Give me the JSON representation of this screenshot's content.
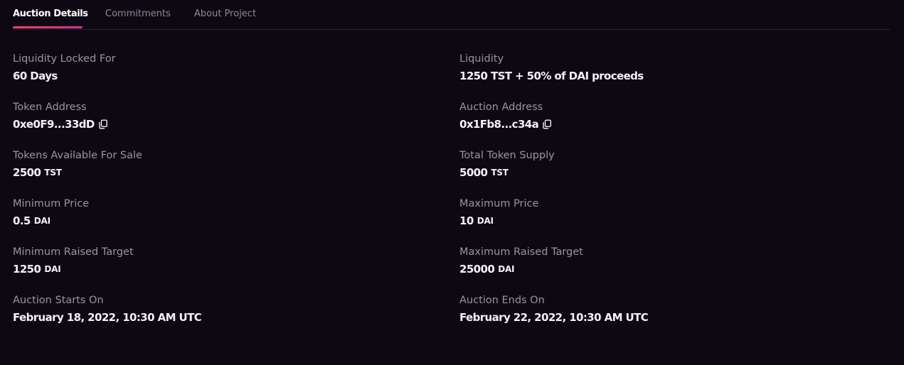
{
  "tabs": [
    {
      "label": "Auction Details",
      "active": true
    },
    {
      "label": "Commitments",
      "active": false
    },
    {
      "label": "About Project",
      "active": false
    }
  ],
  "colors": {
    "background": "#0d0812",
    "accent_gradient_start": "#f0436a",
    "accent_gradient_end": "#c23ba4"
  },
  "details": {
    "liquidity_locked": {
      "label": "Liquidity Locked For",
      "value": "60 Days"
    },
    "liquidity": {
      "label": "Liquidity",
      "value": "1250 TST + 50% of DAI proceeds"
    },
    "token_address": {
      "label": "Token Address",
      "value": "0xe0F9...33dD",
      "icon": "copy-icon"
    },
    "auction_address": {
      "label": "Auction Address",
      "value": "0x1Fb8...c34a",
      "icon": "copy-icon"
    },
    "tokens_for_sale": {
      "label": "Tokens Available For Sale",
      "value": "2500",
      "unit": "TST"
    },
    "total_supply": {
      "label": "Total Token Supply",
      "value": "5000",
      "unit": "TST"
    },
    "min_price": {
      "label": "Minimum Price",
      "value": "0.5",
      "unit": "DAI"
    },
    "max_price": {
      "label": "Maximum Price",
      "value": "10",
      "unit": "DAI"
    },
    "min_target": {
      "label": "Minimum Raised Target",
      "value": "1250",
      "unit": "DAI"
    },
    "max_target": {
      "label": "Maximum Raised Target",
      "value": "25000",
      "unit": "DAI"
    },
    "starts_on": {
      "label": "Auction Starts On",
      "value": "February 18, 2022, 10:30 AM UTC"
    },
    "ends_on": {
      "label": "Auction Ends On",
      "value": "February 22, 2022, 10:30 AM UTC"
    }
  }
}
